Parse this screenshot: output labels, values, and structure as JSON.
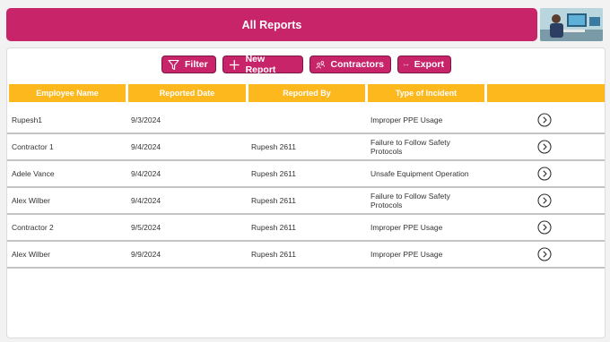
{
  "header": {
    "title": "All Reports"
  },
  "toolbar": {
    "filter_label": "Filter",
    "new_report_label": "New Report",
    "contractors_label": "Contractors",
    "export_label": "Export"
  },
  "table": {
    "columns": [
      "Employee Name",
      "Reported Date",
      "Reported By",
      "Type of Incident",
      ""
    ],
    "rows": [
      {
        "employee": "Rupesh1",
        "date": "9/3/2024",
        "reported_by": "",
        "incident": "Improper PPE Usage"
      },
      {
        "employee": "Contractor 1",
        "date": "9/4/2024",
        "reported_by": "Rupesh 2611",
        "incident": "Failure to Follow Safety Protocols"
      },
      {
        "employee": "Adele Vance",
        "date": "9/4/2024",
        "reported_by": "Rupesh 2611",
        "incident": "Unsafe Equipment Operation"
      },
      {
        "employee": "Alex Wilber",
        "date": "9/4/2024",
        "reported_by": "Rupesh 2611",
        "incident": "Failure to Follow Safety Protocols"
      },
      {
        "employee": "Contractor 2",
        "date": "9/5/2024",
        "reported_by": "Rupesh 2611",
        "incident": "Improper PPE Usage"
      },
      {
        "employee": "Alex Wilber",
        "date": "9/9/2024",
        "reported_by": "Rupesh 2611",
        "incident": "Improper PPE Usage"
      }
    ]
  },
  "icons": {
    "filter": "filter-icon",
    "new_report": "plus-icon",
    "contractors": "people-icon",
    "export": "export-arrow-icon",
    "row_action": "chevron-right-circle-icon"
  },
  "colors": {
    "brand": "#c8246a",
    "header_column": "#fdb81e",
    "row_divider": "#c4c4c4"
  }
}
